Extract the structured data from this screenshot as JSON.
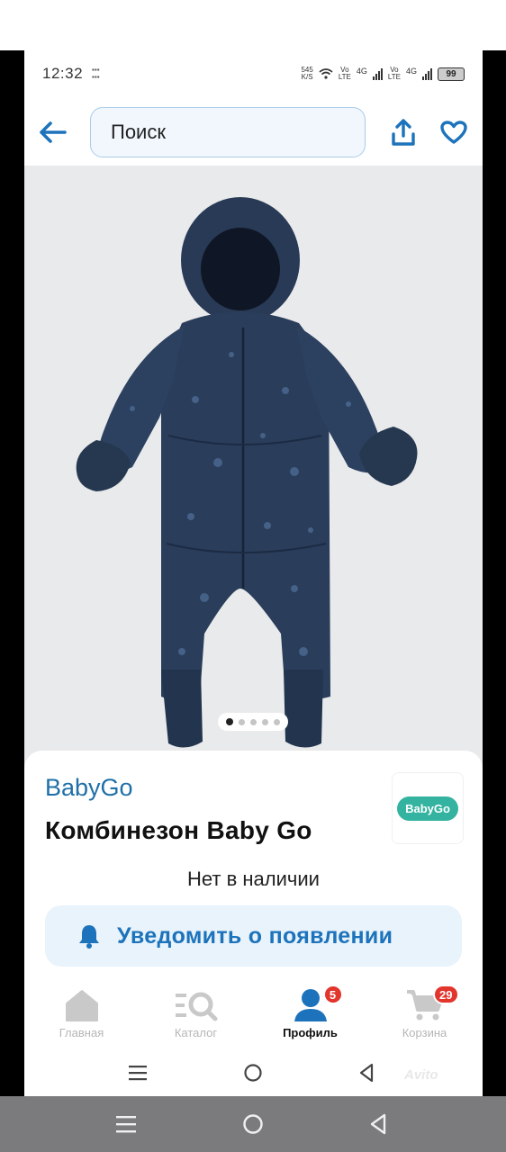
{
  "status_bar": {
    "time": "12:32",
    "net_speed_top": "545",
    "net_speed_bottom": "K/S",
    "sim1_top": "Vo",
    "sim1_bottom": "LTE",
    "sim1_gen": "4G",
    "sim2_top": "Vo",
    "sim2_bottom": "LTE",
    "sim2_gen": "4G",
    "battery": "99"
  },
  "header": {
    "search_placeholder": "Поиск",
    "icons": {
      "back": "arrow-left-icon",
      "share": "share-icon",
      "favorite": "heart-icon"
    },
    "accent_color": "#1d73bb"
  },
  "gallery": {
    "image_count": 5,
    "active_index": 0,
    "image_subject": "navy baby snowsuit with hood"
  },
  "product": {
    "brand": "BabyGo",
    "title": "Комбинезон Baby Go",
    "brand_logo_text": "BabyGo",
    "availability": "Нет в наличии",
    "notify_button": "Уведомить о появлении"
  },
  "bottom_nav": {
    "items": [
      {
        "label": "Главная",
        "icon": "home-icon",
        "active": false
      },
      {
        "label": "Каталог",
        "icon": "catalog-search-icon",
        "active": false
      },
      {
        "label": "Профиль",
        "icon": "profile-icon",
        "active": true,
        "badge": "5"
      },
      {
        "label": "Корзина",
        "icon": "cart-icon",
        "active": false,
        "badge": "29"
      }
    ]
  },
  "watermark": "Avito",
  "colors": {
    "brand_blue": "#1d73bb",
    "badge_red": "#e2352c",
    "logo_green": "#33b3a0"
  }
}
